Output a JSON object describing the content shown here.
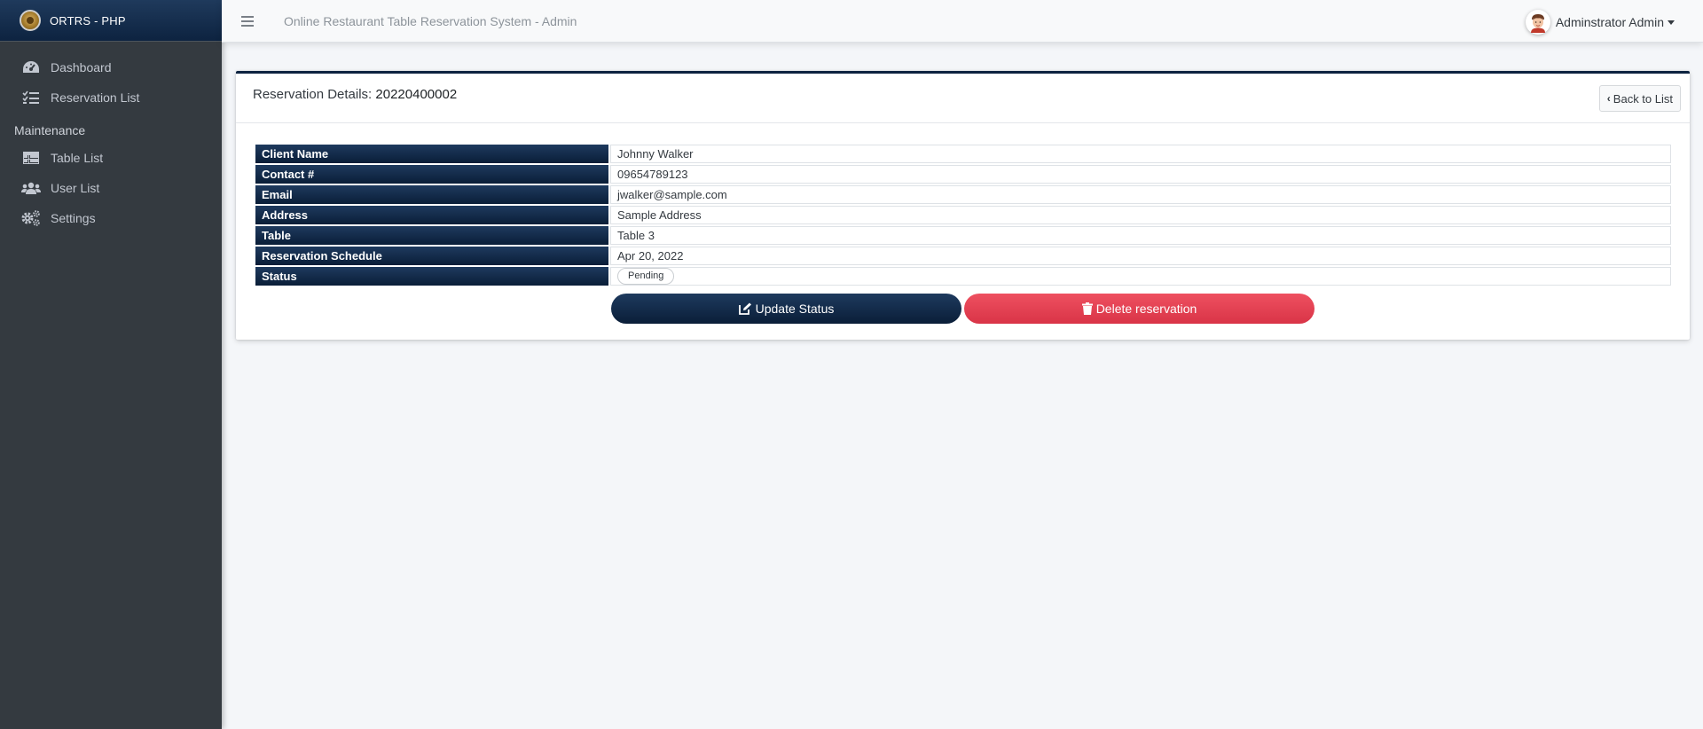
{
  "sidebar": {
    "brand": "ORTRS - PHP",
    "items": [
      {
        "label": "Dashboard",
        "icon": "tachometer-icon"
      },
      {
        "label": "Reservation List",
        "icon": "tasks-list-icon"
      }
    ],
    "maintenance_header": "Maintenance",
    "maintenance_items": [
      {
        "label": "Table List",
        "icon": "table-icon"
      },
      {
        "label": "User List",
        "icon": "users-icon"
      },
      {
        "label": "Settings",
        "icon": "cogs-icon"
      }
    ]
  },
  "topbar": {
    "system_title": "Online Restaurant Table Reservation System - Admin",
    "user_name": "Adminstrator Admin"
  },
  "card": {
    "title_prefix": "Reservation Details:",
    "reservation_code": "20220400002",
    "back_label": "Back to List",
    "details": [
      {
        "label": "Client Name",
        "value": "Johnny Walker"
      },
      {
        "label": "Contact #",
        "value": "09654789123"
      },
      {
        "label": "Email",
        "value": "jwalker@sample.com"
      },
      {
        "label": "Address",
        "value": "Sample Address"
      },
      {
        "label": "Table",
        "value": "Table 3"
      },
      {
        "label": "Reservation Schedule",
        "value": "Apr 20, 2022"
      },
      {
        "label": "Status",
        "value": "Pending"
      }
    ],
    "update_label": "Update Status",
    "delete_label": "Delete reservation"
  },
  "colors": {
    "primary": "#0d2340",
    "danger": "#dc3545",
    "sidebar_bg": "#343a40",
    "page_bg": "#f4f6f9"
  }
}
